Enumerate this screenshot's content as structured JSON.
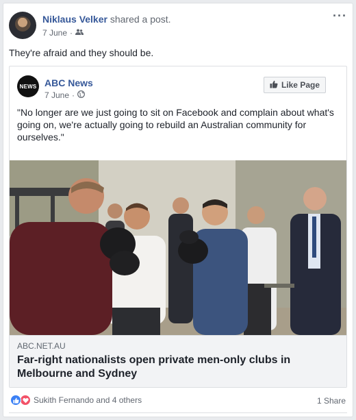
{
  "post": {
    "author": "Niklaus Velker",
    "action": "shared a post.",
    "date": "7 June",
    "audience_icon": "friends-icon",
    "text": "They're afraid and they should be."
  },
  "shared_post": {
    "page_name": "ABC News",
    "logo_text": "NEWS",
    "date": "7 June",
    "audience_icon": "globe-icon",
    "like_page_label": "Like Page",
    "quote": "\"No longer are we just going to sit on Facebook and complain about what's going on, we're actually going to rebuild an Australian community for ourselves.\"",
    "link": {
      "domain": "ABC.NET.AU",
      "title": "Far-right nationalists open private men-only clubs in Melbourne and Sydney"
    }
  },
  "footer": {
    "reactions": "Sukith Fernando and 4 others",
    "shares": "1 Share"
  },
  "colors": {
    "link_blue": "#365899",
    "like_blue": "#3b80f5",
    "love_red": "#f25268",
    "meta_gray": "#616770"
  }
}
